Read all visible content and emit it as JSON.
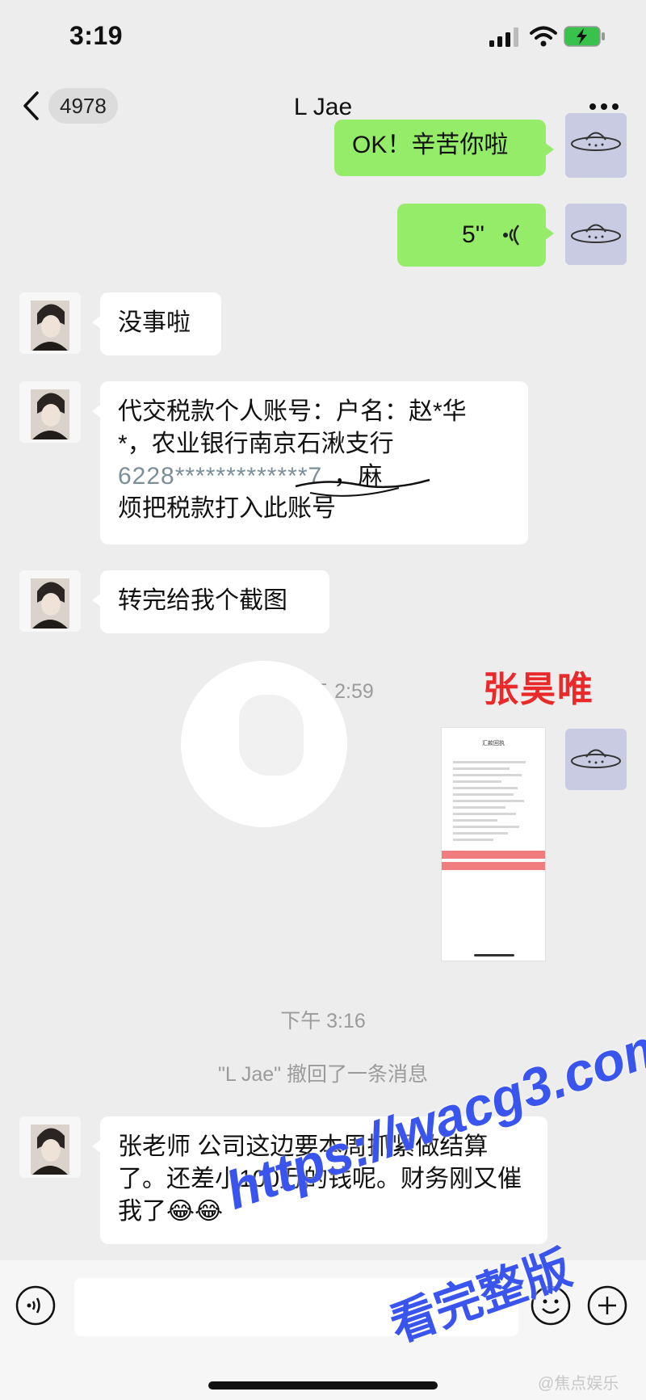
{
  "status_bar": {
    "time": "3:19"
  },
  "nav": {
    "unread_count": "4978",
    "title": "L Jae"
  },
  "messages": {
    "m1": "OK！辛苦你啦",
    "m2_duration": "5''",
    "m3": "没事啦",
    "m4_line1": "代交税款个人账号：户名：赵*华",
    "m4_line2": "*，农业银行南京石湫支行",
    "m4_line3a": "6228*************7",
    "m4_line3b": "，麻",
    "m4_line4": "烦把税款打入此账号",
    "m5": "转完给我个截图",
    "m7": "张老师 公司这边要本周抓紧做结算了。还差小100万的钱呢。财务刚又催我了😂😂"
  },
  "system": {
    "time1": "下午 2:59",
    "time2": "下午 3:16",
    "recall": "\"L Jae\" 撤回了一条消息"
  },
  "overlay": {
    "name": "张昊唯"
  },
  "thumbnail": {
    "title": "汇款回执"
  },
  "watermark": {
    "url": "https://wacg3.com",
    "tagline": "看完整版",
    "source": "@焦点娱乐"
  },
  "icons": [
    "back-chevron-icon",
    "signal-icon",
    "wifi-icon",
    "battery-charging-icon",
    "more-icon",
    "voice-wave-icon",
    "voice-input-icon",
    "emoji-icon",
    "plus-icon",
    "ufo-avatar-icon"
  ],
  "colors": {
    "sent_bubble": "#95ec69",
    "received_bubble": "#ffffff",
    "background": "#ededed",
    "overlay_red": "#ea2a2a",
    "watermark_blue": "#3a55ee"
  }
}
